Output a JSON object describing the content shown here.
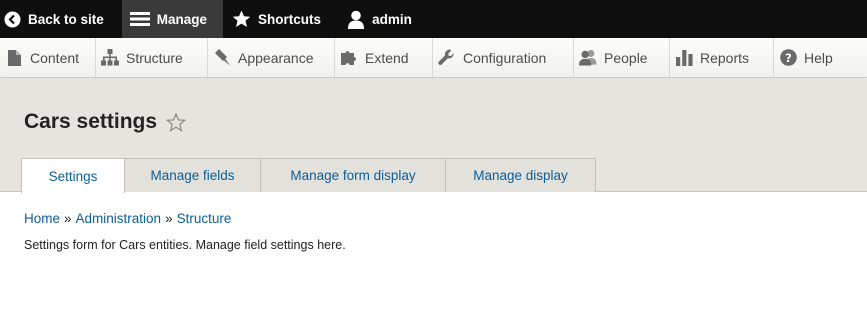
{
  "toolbar": {
    "back": "Back to site",
    "manage": "Manage",
    "shortcuts": "Shortcuts",
    "user": "admin"
  },
  "tray": {
    "items": [
      {
        "label": "Content",
        "icon": "file-icon"
      },
      {
        "label": "Structure",
        "icon": "sitemap-icon"
      },
      {
        "label": "Appearance",
        "icon": "paintbrush-icon"
      },
      {
        "label": "Extend",
        "icon": "puzzle-icon"
      },
      {
        "label": "Configuration",
        "icon": "wrench-icon"
      },
      {
        "label": "People",
        "icon": "people-icon"
      },
      {
        "label": "Reports",
        "icon": "bar-chart-icon"
      },
      {
        "label": "Help",
        "icon": "help-icon"
      }
    ]
  },
  "page": {
    "title": "Cars settings"
  },
  "tabs": [
    {
      "label": "Settings",
      "active": true
    },
    {
      "label": "Manage fields",
      "active": false
    },
    {
      "label": "Manage form display",
      "active": false
    },
    {
      "label": "Manage display",
      "active": false
    }
  ],
  "breadcrumb": {
    "items": [
      "Home",
      "Administration",
      "Structure"
    ],
    "separator": "»"
  },
  "content": {
    "description": "Settings form for Cars entities. Manage field settings here."
  },
  "colors": {
    "toolbar_bg": "#0f0f0f",
    "active_item_bg": "#3a3a3a",
    "link": "#0c5e9c",
    "header_bg": "#e5e4de"
  }
}
